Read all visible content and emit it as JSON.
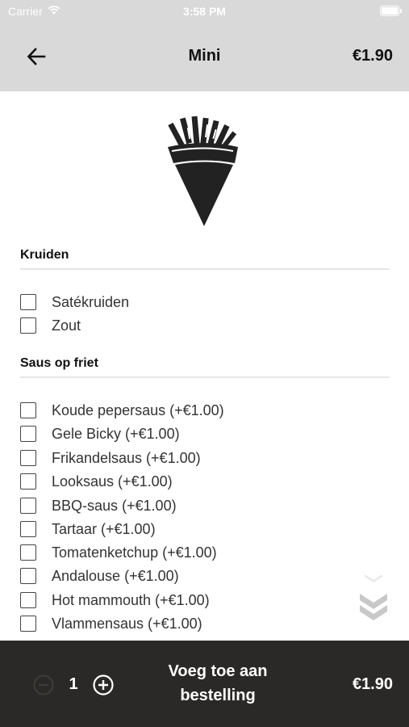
{
  "status_bar": {
    "carrier": "Carrier",
    "time": "3:58 PM"
  },
  "header": {
    "title": "Mini",
    "price": "€1.90"
  },
  "hero": {
    "icon": "french-fries-cone-icon"
  },
  "sections": [
    {
      "title": "Kruiden",
      "options": [
        {
          "label": "Satékruiden",
          "checked": false
        },
        {
          "label": "Zout",
          "checked": false
        }
      ]
    },
    {
      "title": "Saus op friet",
      "options": [
        {
          "label": "Koude pepersaus (+€1.00)",
          "checked": false
        },
        {
          "label": "Gele Bicky (+€1.00)",
          "checked": false
        },
        {
          "label": "Frikandelsaus (+€1.00)",
          "checked": false
        },
        {
          "label": "Looksaus (+€1.00)",
          "checked": false
        },
        {
          "label": "BBQ-saus (+€1.00)",
          "checked": false
        },
        {
          "label": "Tartaar (+€1.00)",
          "checked": false
        },
        {
          "label": "Tomatenketchup (+€1.00)",
          "checked": false
        },
        {
          "label": "Andalouse (+€1.00)",
          "checked": false
        },
        {
          "label": "Hot mammouth (+€1.00)",
          "checked": false
        },
        {
          "label": "Vlammensaus (+€1.00)",
          "checked": false
        }
      ]
    }
  ],
  "footer": {
    "quantity": "1",
    "add_button_line1": "Voeg toe aan",
    "add_button_line2": "bestelling",
    "total": "€1.90"
  },
  "colors": {
    "header_bg": "#d9d9d9",
    "footer_bg": "#2b2927",
    "divider": "#e6e6e6"
  }
}
